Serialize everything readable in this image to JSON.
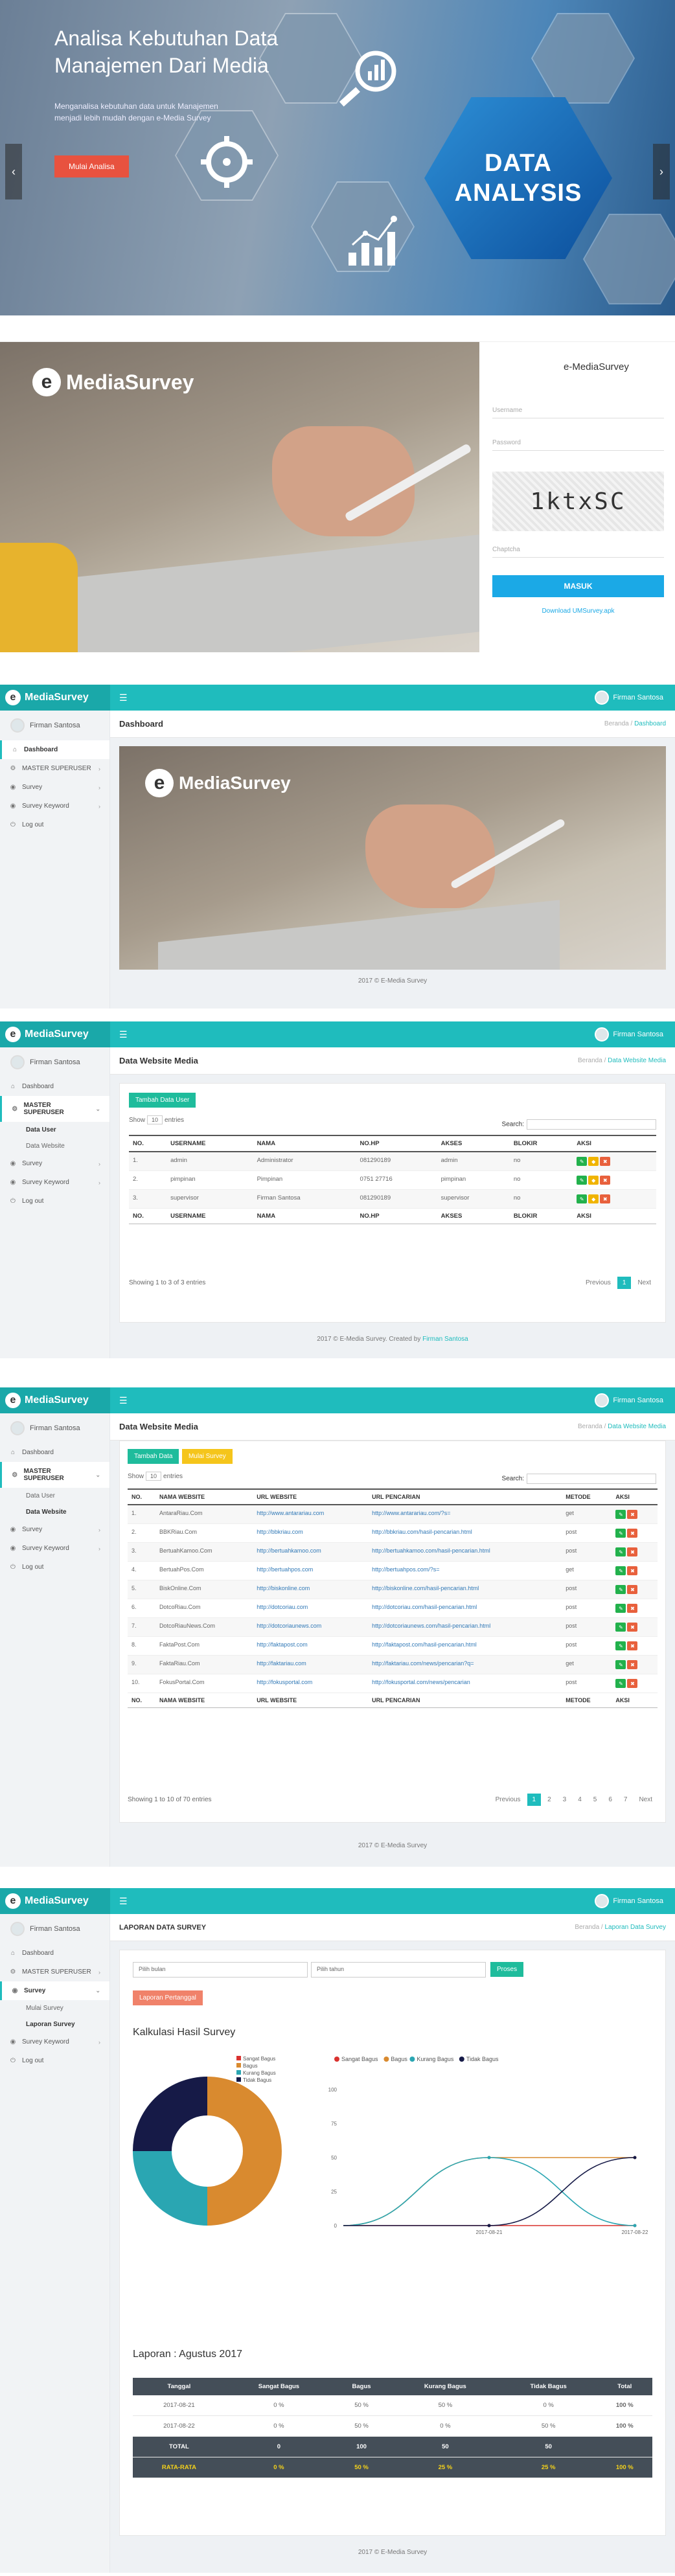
{
  "hero": {
    "title": "Analisa Kebutuhan Data Manajemen Dari Media",
    "subtitle": "Menganalisa kebutuhan data untuk Manajemen menjadi lebih mudah dengan e-Media Survey",
    "button": "Mulai Analisa",
    "badge_line1": "DATA",
    "badge_line2": "ANALYSIS",
    "prev_icon": "chevron-left-icon",
    "next_icon": "chevron-right-icon"
  },
  "login": {
    "brand": "MediaSurvey",
    "form_brand": "e-MediaSurvey",
    "username_label": "Username",
    "password_label": "Password",
    "captcha_text": "1ktxSC",
    "captcha_label": "Chaptcha",
    "submit": "MASUK",
    "download": "Download UMSurvey.apk"
  },
  "app": {
    "brand": "MediaSurvey",
    "user": "Firman Santosa",
    "menu": {
      "dashboard": "Dashboard",
      "master": "MASTER SUPERUSER",
      "data_user": "Data User",
      "data_website": "Data Website",
      "survey": "Survey",
      "mulai_survey": "Mulai Survey",
      "laporan_survey": "Laporan Survey",
      "survey_keyword": "Survey Keyword",
      "logout": "Log out"
    },
    "crumb_root": "Beranda"
  },
  "dash": {
    "title": "Dashboard",
    "crumb": "Dashboard",
    "footer": "2017 © E-Media Survey"
  },
  "users": {
    "title": "Data Website Media",
    "crumb": "Data Website Media",
    "add_button": "Tambah Data User",
    "show_prefix": "Show",
    "show_value": "10",
    "show_suffix": "entries",
    "search_label": "Search:",
    "columns": [
      "NO.",
      "USERNAME",
      "NAMA",
      "NO.HP",
      "AKSES",
      "BLOKIR",
      "AKSI"
    ],
    "rows": [
      [
        "1.",
        "admin",
        "Administrator",
        "081290189",
        "admin",
        "no"
      ],
      [
        "2.",
        "pimpinan",
        "Pimpinan",
        "0751 27716",
        "pimpinan",
        "no"
      ],
      [
        "3.",
        "supervisor",
        "Firman Santosa",
        "081290189",
        "supervisor",
        "no"
      ]
    ],
    "info": "Showing 1 to 3 of 3 entries",
    "pages": [
      "Previous",
      "1",
      "Next"
    ],
    "footer_text": "2017 © E-Media Survey. Created by",
    "footer_author": "Firman Santosa"
  },
  "websites": {
    "title": "Data Website Media",
    "crumb": "Data Website Media",
    "add_button": "Tambah Data",
    "survey_button": "Mulai Survey",
    "show_prefix": "Show",
    "show_value": "10",
    "show_suffix": "entries",
    "search_label": "Search:",
    "columns": [
      "NO.",
      "NAMA WEBSITE",
      "URL WEBSITE",
      "URL PENCARIAN",
      "METODE",
      "AKSI"
    ],
    "rows": [
      [
        "1.",
        "AntaraRiau.Com",
        "http://www.antarariau.com",
        "http://www.antarariau.com/?s=",
        "get"
      ],
      [
        "2.",
        "BBKRiau.Com",
        "http://bbkriau.com",
        "http://bbkriau.com/hasil-pencarian.html",
        "post"
      ],
      [
        "3.",
        "BertuahKamoo.Com",
        "http://bertuahkamoo.com",
        "http://bertuahkamoo.com/hasil-pencarian.html",
        "post"
      ],
      [
        "4.",
        "BertuahPos.Com",
        "http://bertuahpos.com",
        "http://bertuahpos.com/?s=",
        "get"
      ],
      [
        "5.",
        "BiskOnline.Com",
        "http://biskonline.com",
        "http://biskonline.com/hasil-pencarian.html",
        "post"
      ],
      [
        "6.",
        "DotcoRiau.Com",
        "http://dotcoriau.com",
        "http://dotcoriau.com/hasil-pencarian.html",
        "post"
      ],
      [
        "7.",
        "DotcoRiauNews.Com",
        "http://dotcoriaunews.com",
        "http://dotcoriaunews.com/hasil-pencarian.html",
        "post"
      ],
      [
        "8.",
        "FaktaPost.Com",
        "http://faktapost.com",
        "http://faktapost.com/hasil-pencarian.html",
        "post"
      ],
      [
        "9.",
        "FaktaRiau.Com",
        "http://faktariau.com",
        "http://faktariau.com/news/pencarian?q=",
        "get"
      ],
      [
        "10.",
        "FokusPortal.Com",
        "http://fokusportal.com",
        "http://fokusportal.com/news/pencarian",
        "post"
      ]
    ],
    "info": "Showing 1 to 10 of 70 entries",
    "pages": [
      "Previous",
      "1",
      "2",
      "3",
      "4",
      "5",
      "6",
      "7",
      "Next"
    ],
    "footer": "2017 © E-Media Survey"
  },
  "report": {
    "title": "LAPORAN DATA SURVEY",
    "crumb": "Laporan Data Survey",
    "month_placeholder": "Pilih bulan",
    "year_placeholder": "Pilih tahun",
    "process_button": "Proses",
    "date_button": "Laporan Pertanggal",
    "calc_title": "Kalkulasi Hasil Survey",
    "period_title": "Laporan : Agustus 2017",
    "columns": [
      "Tanggal",
      "Sangat Bagus",
      "Bagus",
      "Kurang Bagus",
      "Tidak Bagus",
      "Total"
    ],
    "rows": [
      [
        "2017-08-21",
        "0 %",
        "50 %",
        "50 %",
        "0 %",
        "100 %"
      ],
      [
        "2017-08-22",
        "0 %",
        "50 %",
        "0 %",
        "50 %",
        "100 %"
      ]
    ],
    "total": [
      "TOTAL",
      "0",
      "100",
      "50",
      "50",
      ""
    ],
    "avg": [
      "RATA-RATA",
      "0 %",
      "50 %",
      "25 %",
      "25 %",
      "100 %"
    ],
    "footer": "2017 © E-Media Survey"
  },
  "chart_data": [
    {
      "type": "pie",
      "labels": [
        "Sangat Bagus",
        "Bagus",
        "Kurang Bagus",
        "Tidak Bagus"
      ],
      "values": [
        0,
        50,
        25,
        25
      ],
      "colors": [
        "#d9322f",
        "#d98a2f",
        "#2aa6b2",
        "#161a47"
      ],
      "legend": "top-right"
    },
    {
      "type": "line",
      "x": [
        "2017-08-21",
        "2017-08-22"
      ],
      "series": [
        {
          "name": "Sangat Bagus",
          "values": [
            0,
            0
          ],
          "color": "#d9322f"
        },
        {
          "name": "Bagus",
          "values": [
            50,
            50
          ],
          "color": "#d98a2f"
        },
        {
          "name": "Kurang Bagus",
          "values": [
            50,
            0
          ],
          "color": "#2aa6b2"
        },
        {
          "name": "Tidak Bagus",
          "values": [
            0,
            50
          ],
          "color": "#161a47"
        }
      ],
      "yticks": [
        "0",
        "25",
        "50",
        "75",
        "100"
      ],
      "ylim": [
        0,
        100
      ],
      "legend": "top"
    }
  ]
}
